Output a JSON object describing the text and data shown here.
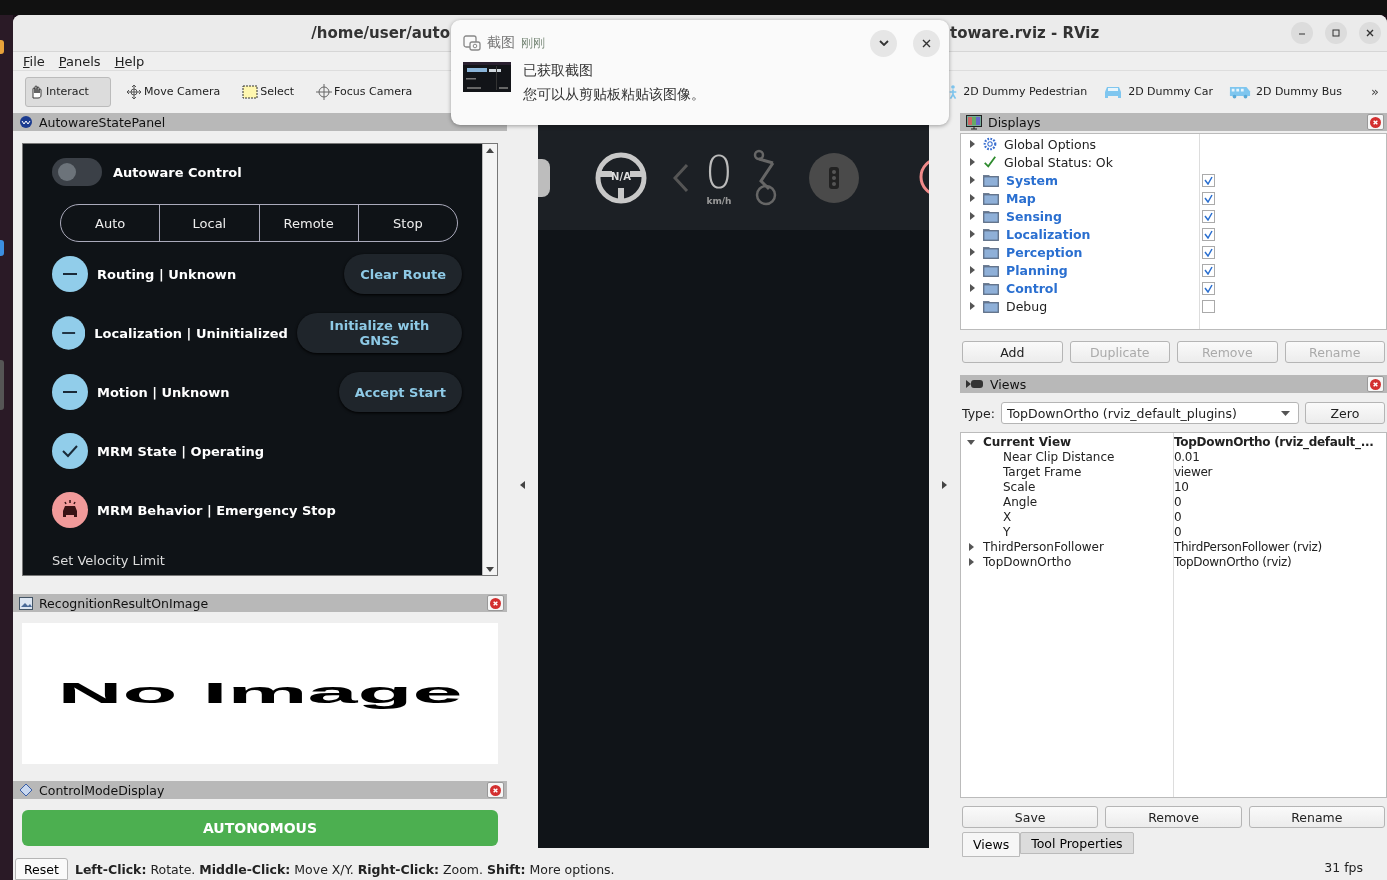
{
  "window": {
    "title_left": "/home/user/auto",
    "title_right": "toware.rviz - RViz"
  },
  "menu": [
    "File",
    "Panels",
    "Help"
  ],
  "toolbar": {
    "tools": [
      {
        "label": "Interact",
        "kind": "hand",
        "selected": true
      },
      {
        "label": "Move Camera",
        "kind": "move",
        "selected": false
      },
      {
        "label": "Select",
        "kind": "select",
        "selected": false
      },
      {
        "label": "Focus Camera",
        "kind": "focus",
        "selected": false
      }
    ],
    "tools_right": [
      {
        "label": "2D Dummy Pedestrian",
        "kind": "pedestrian",
        "selected": false
      },
      {
        "label": "2D Dummy Car",
        "kind": "car",
        "selected": false
      },
      {
        "label": "2D Dummy Bus",
        "kind": "bus",
        "selected": false
      }
    ],
    "overflow": "»"
  },
  "autoware_panel": {
    "title": "AutowareStatePanel",
    "control": {
      "label": "Autoware Control",
      "on": false
    },
    "modes": [
      {
        "label": "Auto",
        "selected": false
      },
      {
        "label": "Local",
        "selected": false
      },
      {
        "label": "Remote",
        "selected": false
      },
      {
        "label": "Stop",
        "selected": false
      }
    ],
    "rows": [
      {
        "label": "Routing | Unknown",
        "kind": "unknown",
        "button": "Clear Route"
      },
      {
        "label": "Localization | Uninitialized",
        "kind": "unknown",
        "button": "Initialize with GNSS"
      },
      {
        "label": "Motion | Unknown",
        "kind": "unknown",
        "button": "Accept Start"
      },
      {
        "label": "MRM State | Operating",
        "kind": "ok"
      },
      {
        "label": "MRM Behavior | Emergency Stop",
        "kind": "emergency"
      }
    ],
    "velocity_label": "Set Velocity Limit"
  },
  "recognition_panel": {
    "title": "RecognitionResultOnImage",
    "message": "No Image"
  },
  "control_mode_panel": {
    "title": "ControlModeDisplay",
    "mode": "AUTONOMOUS",
    "kind": "autonomous"
  },
  "hud": {
    "gear": "N/A",
    "speed": "0",
    "speed_unit": "km/h"
  },
  "notification": {
    "app": "截图",
    "time": "刚刚",
    "title": "已获取截图",
    "body": "您可以从剪贴板粘贴该图像。"
  },
  "displays": {
    "title": "Displays",
    "items": [
      {
        "label": "Global Options",
        "kind": "options"
      },
      {
        "label": "Global Status: Ok",
        "kind": "status"
      },
      {
        "label": "System",
        "kind": "folder",
        "checked": true
      },
      {
        "label": "Map",
        "kind": "folder",
        "checked": true
      },
      {
        "label": "Sensing",
        "kind": "folder",
        "checked": true
      },
      {
        "label": "Localization",
        "kind": "folder",
        "checked": true
      },
      {
        "label": "Perception",
        "kind": "folder",
        "checked": true
      },
      {
        "label": "Planning",
        "kind": "folder",
        "checked": true
      },
      {
        "label": "Control",
        "kind": "folder",
        "checked": true
      },
      {
        "label": "Debug",
        "kind": "folder",
        "checked": false
      }
    ],
    "buttons": [
      {
        "label": "Add",
        "disabled": false
      },
      {
        "label": "Duplicate",
        "disabled": true
      },
      {
        "label": "Remove",
        "disabled": true
      },
      {
        "label": "Rename",
        "disabled": true
      }
    ]
  },
  "views": {
    "title": "Views",
    "type_label": "Type:",
    "type_value": "TopDownOrtho (rviz_default_plugins)",
    "zero": "Zero",
    "tree": [
      {
        "name": "Current View",
        "value": "TopDownOrtho (rviz_default_...",
        "current": true,
        "expanded": true,
        "children": [
          {
            "name": "Near Clip Distance",
            "value": "0.01"
          },
          {
            "name": "Target Frame",
            "value": "viewer"
          },
          {
            "name": "Scale",
            "value": "10"
          },
          {
            "name": "Angle",
            "value": "0"
          },
          {
            "name": "X",
            "value": "0"
          },
          {
            "name": "Y",
            "value": "0"
          }
        ]
      },
      {
        "name": "ThirdPersonFollower",
        "value": "ThirdPersonFollower (rviz)",
        "current": false,
        "expanded": false
      },
      {
        "name": "TopDownOrtho",
        "value": "TopDownOrtho (rviz)",
        "current": false,
        "expanded": false
      }
    ],
    "buttons": [
      "Save",
      "Remove",
      "Rename"
    ],
    "tabs": [
      {
        "label": "Views",
        "selected": true
      },
      {
        "label": "Tool Properties",
        "selected": false
      }
    ]
  },
  "status_bar": {
    "reset": "Reset",
    "help": "**Left-Click:** Rotate. **Middle-Click:** Move X/Y. **Right-Click:** Zoom. **Shift:** More options.",
    "fps": "31 fps"
  }
}
